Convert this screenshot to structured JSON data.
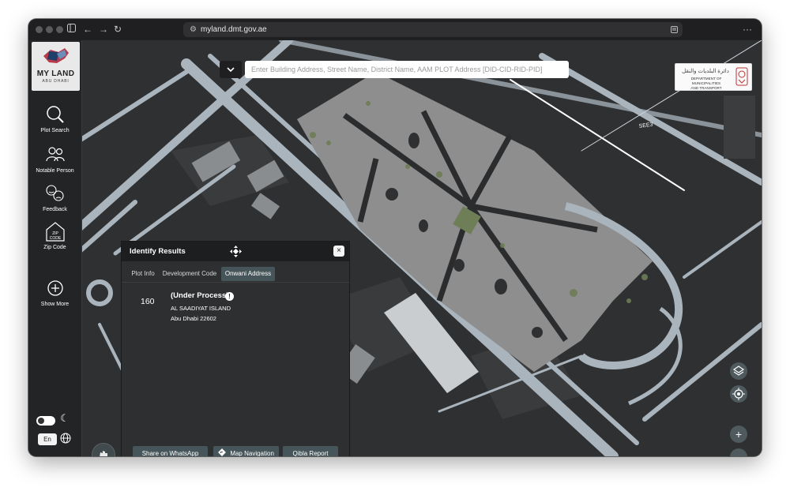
{
  "browser": {
    "url": "myland.dmt.gov.ae",
    "icons": [
      "sidebar-toggle-icon",
      "back-arrow-icon",
      "forward-arrow-icon",
      "reload-icon",
      "site-settings-icon",
      "reader-icon",
      "more-icon"
    ]
  },
  "app": {
    "logo_title": "MY LAND",
    "logo_subtitle": "ABU DHABI",
    "search_placeholder": "Enter Building Address, Street Name, District Name, AAM PLOT Address [DID-CID-RID-PID]",
    "dmt_logo": {
      "arabic": "دائرة البلديات والنقل",
      "english_line1": "DEPARTMENT OF MUNICIPALITIES",
      "english_line2": "AND TRANSPORT"
    },
    "map_road_label": "SEE3"
  },
  "sidebar": {
    "items": [
      {
        "label": "Plot Search",
        "icon": "magnifier-icon"
      },
      {
        "label": "Notable Person",
        "icon": "people-icon"
      },
      {
        "label": "Feedback",
        "icon": "feedback-faces-icon"
      },
      {
        "label": "Zip Code",
        "icon": "zip-code-house-icon",
        "icon_text": "ZIP\nCODE"
      },
      {
        "label": "Show More",
        "icon": "plus-circle-icon"
      }
    ],
    "language_button": "En"
  },
  "identify_panel": {
    "title": "Identify Results",
    "tabs": [
      {
        "label": "Plot Info",
        "active": false
      },
      {
        "label": "Development Code",
        "active": false
      },
      {
        "label": "Onwani Address",
        "active": true
      }
    ],
    "plot_number": "160",
    "status": "(Under Process)",
    "address_line1": "AL SAADIYAT ISLAND",
    "address_line2": "Abu Dhabi 22602",
    "actions": [
      "Share on WhatsApp",
      "Map Navigation",
      "Qibla Report"
    ],
    "close_label": "×"
  },
  "map_controls": {
    "zoom_in": "+",
    "zoom_out": "−"
  },
  "colors": {
    "map_background": "#2f3032",
    "road": "#a9b4bd",
    "park": "#8c8c8c",
    "accent_tab": "#45555a",
    "sidebar": "#232426"
  }
}
